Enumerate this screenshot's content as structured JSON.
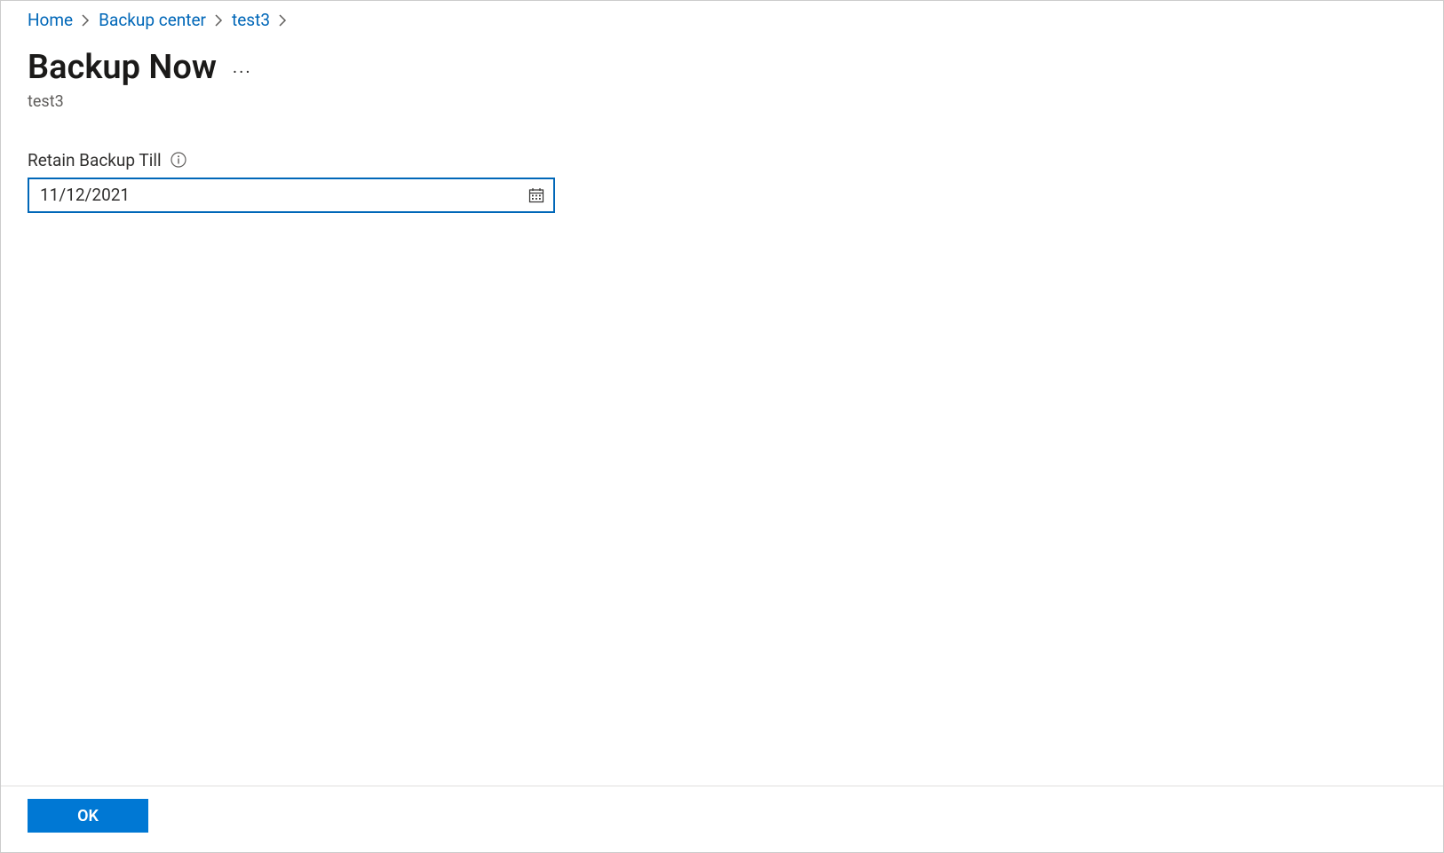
{
  "breadcrumb": {
    "items": [
      {
        "label": "Home"
      },
      {
        "label": "Backup center"
      },
      {
        "label": "test3"
      }
    ]
  },
  "header": {
    "title": "Backup Now",
    "subtitle": "test3"
  },
  "form": {
    "retain_label": "Retain Backup Till",
    "retain_value": "11/12/2021"
  },
  "footer": {
    "ok_label": "OK"
  }
}
